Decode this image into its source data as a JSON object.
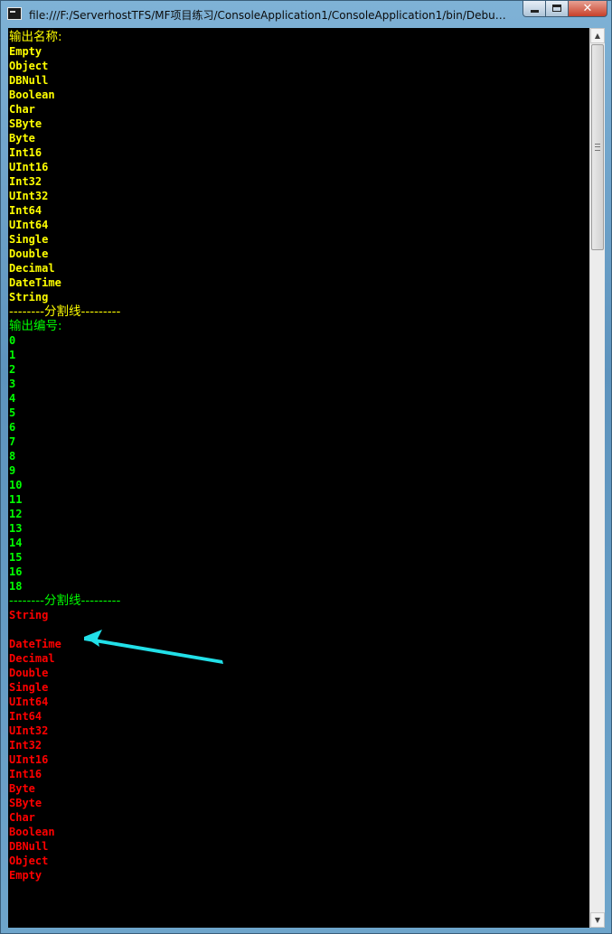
{
  "window": {
    "title": "file:///F:/ServerhostTFS/MF项目练习/ConsoleApplication1/ConsoleApplication1/bin/Debug...",
    "buttons": {
      "minimize": "minimize",
      "maximize": "maximize",
      "close": "✕"
    }
  },
  "console": {
    "background": "#000000",
    "colors": {
      "yellow": "#FFFF00",
      "green": "#00FF00",
      "red": "#FF0000"
    },
    "names_header": "输出名称:",
    "names": [
      "Empty",
      "Object",
      "DBNull",
      "Boolean",
      "Char",
      "SByte",
      "Byte",
      "Int16",
      "UInt16",
      "Int32",
      "UInt32",
      "Int64",
      "UInt64",
      "Single",
      "Double",
      "Decimal",
      "DateTime",
      "String"
    ],
    "separator_1": "--------分割线---------",
    "numbers_header": "输出编号:",
    "numbers": [
      "0",
      "1",
      "2",
      "3",
      "4",
      "5",
      "6",
      "7",
      "8",
      "9",
      "10",
      "11",
      "12",
      "13",
      "14",
      "15",
      "16",
      "18"
    ],
    "separator_2": "--------分割线---------",
    "reversed_names": [
      "String",
      "",
      "DateTime",
      "Decimal",
      "Double",
      "Single",
      "UInt64",
      "Int64",
      "UInt32",
      "Int32",
      "UInt16",
      "Int16",
      "Byte",
      "SByte",
      "Char",
      "Boolean",
      "DBNull",
      "Object",
      "Empty"
    ]
  },
  "annotation": {
    "icon": "arrow-icon",
    "color": "#22E0E8"
  },
  "scrollbar": {
    "icon_up": "▲",
    "icon_down": "▼"
  }
}
